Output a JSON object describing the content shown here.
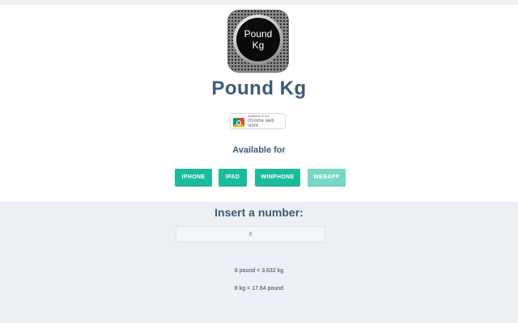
{
  "app": {
    "title": "Pound Kg",
    "icon_line1": "Pound",
    "icon_line2": "Kg"
  },
  "store_badge": {
    "line1": "available in the",
    "line2": "chrome web store"
  },
  "available_for": {
    "label": "Available for",
    "platforms": [
      "IPHONE",
      "IPAD",
      "WINPHONE",
      "WEBAPP"
    ]
  },
  "converter": {
    "label": "Insert a number:",
    "input_value": "8",
    "result_pound_to_kg": "8 pound = 3.632 kg",
    "result_kg_to_pound": "8 kg = 17.64 pound"
  },
  "colors": {
    "accent": "#1abc9c",
    "accent_light": "#76d7c4",
    "heading": "#3d5a78",
    "bottom_background": "#ecf0f4"
  }
}
